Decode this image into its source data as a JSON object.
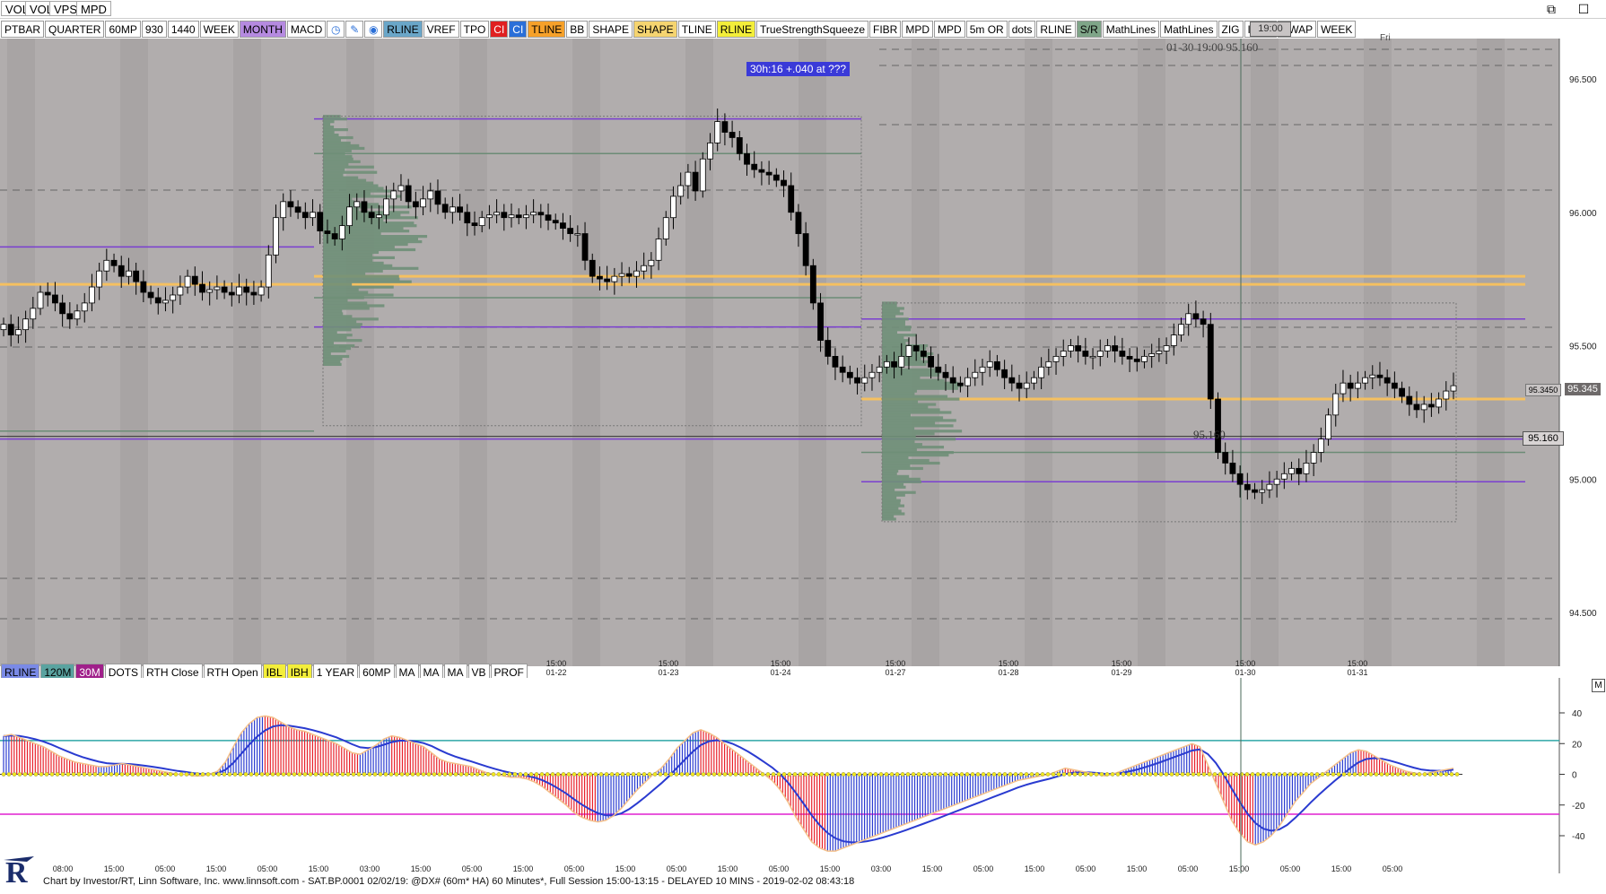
{
  "menu": [
    "VOL",
    "VOL",
    "VPS",
    "MPD"
  ],
  "window_controls": {
    "restore": "⧉",
    "maximize": "☐"
  },
  "toolbar_top": [
    {
      "label": "PTBAR",
      "bg": "#ffffff"
    },
    {
      "label": "QUARTER",
      "bg": "#ffffff"
    },
    {
      "label": "60MP",
      "bg": "#ffffff"
    },
    {
      "label": "930",
      "bg": "#ffffff"
    },
    {
      "label": "1440",
      "bg": "#ffffff"
    },
    {
      "label": "WEEK",
      "bg": "#ffffff"
    },
    {
      "label": "MONTH",
      "bg": "#b58ae0"
    },
    {
      "label": "MACD",
      "bg": "#ffffff"
    },
    {
      "label": "",
      "bg": "#ffffff",
      "icon": "clock-icon"
    },
    {
      "label": "",
      "bg": "#ffffff",
      "icon": "pencil-icon"
    },
    {
      "label": "",
      "bg": "#ffffff",
      "icon": "color-drop-icon"
    },
    {
      "label": "RLINE",
      "bg": "#6aa6c8"
    },
    {
      "label": "VREF",
      "bg": "#ffffff"
    },
    {
      "label": "TPO",
      "bg": "#ffffff"
    },
    {
      "label": "CI",
      "bg": "#e02020"
    },
    {
      "label": "CI",
      "bg": "#2a6fd8"
    },
    {
      "label": "TLINE",
      "bg": "#f6a12a"
    },
    {
      "label": "BB",
      "bg": "#ffffff"
    },
    {
      "label": "SHAPE",
      "bg": "#ffffff"
    },
    {
      "label": "SHAPE",
      "bg": "#f5d470"
    },
    {
      "label": "TLINE",
      "bg": "#ffffff"
    },
    {
      "label": "RLINE",
      "bg": "#f3ee3a"
    },
    {
      "label": "TrueStrengthSqueeze",
      "bg": "#ffffff"
    },
    {
      "label": "FIBR",
      "bg": "#ffffff"
    },
    {
      "label": "MPD",
      "bg": "#ffffff"
    },
    {
      "label": "MPD",
      "bg": "#ffffff"
    },
    {
      "label": "5m OR",
      "bg": "#ffffff"
    },
    {
      "label": "dots",
      "bg": "#ffffff"
    },
    {
      "label": "RLINE",
      "bg": "#ffffff"
    },
    {
      "label": "S/R",
      "bg": "#7fa588"
    },
    {
      "label": "MathLines",
      "bg": "#ffffff"
    },
    {
      "label": "MathLines",
      "bg": "#ffffff"
    },
    {
      "label": "ZIG",
      "bg": "#ffffff"
    },
    {
      "label": "INFO",
      "bg": "#ffffff"
    },
    {
      "label": "VWAP",
      "bg": "#ffffff"
    },
    {
      "label": "WEEK",
      "bg": "#ffffff"
    }
  ],
  "toolbar_bottom": [
    {
      "label": "RLINE",
      "bg": "#7a8ae6"
    },
    {
      "label": "120M",
      "bg": "#5aa3a0"
    },
    {
      "label": "30M",
      "bg": "#a0208a"
    },
    {
      "label": "DOTS",
      "bg": "#ffffff"
    },
    {
      "label": "RTH Close",
      "bg": "#ffffff"
    },
    {
      "label": "RTH Open",
      "bg": "#ffffff"
    },
    {
      "label": "IBL",
      "bg": "#f3ee3a"
    },
    {
      "label": "IBH",
      "bg": "#f3ee3a"
    },
    {
      "label": "1 YEAR",
      "bg": "#ffffff"
    },
    {
      "label": "60MP",
      "bg": "#ffffff"
    },
    {
      "label": "MA",
      "bg": "#ffffff"
    },
    {
      "label": "MA",
      "bg": "#ffffff"
    },
    {
      "label": "MA",
      "bg": "#ffffff"
    },
    {
      "label": "VB",
      "bg": "#ffffff"
    },
    {
      "label": "PROF",
      "bg": "#ffffff"
    }
  ],
  "annotations": {
    "cursor_time_box": "19:00",
    "cursor_readout": "01-30 19:00 95.160",
    "day_label": "Fri",
    "timer_box": "30h:16  +.040 at ???",
    "price_marker": "95.160",
    "last_price_small": "95.3450",
    "last_price": "95.345",
    "cursor_price": "95.160",
    "macd_flag": "M"
  },
  "status_text": "Chart by Investor/RT, Linn Software, Inc. www.linnsoft.com - SAT.BP.0001   02/02/19: @DX# (60m* HA) 60 Minutes*, Full Session 15:00-13:15 - DELAYED 10 MINS - 2019-02-02 08:43:18",
  "colors": {
    "chart_bg": "#b1adad",
    "session_bg": "#a8a4a4",
    "macd_bg": "#ffffff",
    "up_candle": "#ffffff",
    "down_candle": "#000000",
    "profile": "#6f8f78",
    "orange_line": "#f5c060",
    "purple_line": "#7a3fd0",
    "green_line": "#6c8c76",
    "macd_red": "#e8202a",
    "macd_blue": "#2a3bd0",
    "teal_line": "#2fa6a6",
    "magenta_line": "#e020d0"
  },
  "chart_data": [
    {
      "type": "candlestick",
      "title": "@DX# (60m* HA) 60 Minutes*",
      "y_axis_ticks": [
        96.5,
        96.0,
        95.5,
        95.0,
        94.5
      ],
      "ylim": [
        94.2,
        96.75
      ],
      "x_ticks": [
        "15:00 01-22",
        "15:00 01-23",
        "15:00 01-24",
        "15:00 01-27",
        "15:00 01-28",
        "15:00 01-29",
        "15:00 01-30",
        "15:00 01-31"
      ],
      "x_tick_labels_bottom": [
        "08:00",
        "15:00",
        "05:00",
        "15:00",
        "05:00",
        "15:00",
        "03:00",
        "15:00",
        "05:00",
        "15:00",
        "05:00",
        "15:00",
        "05:00",
        "15:00",
        "05:00",
        "15:00",
        "03:00",
        "15:00",
        "05:00",
        "15:00",
        "05:00",
        "15:00",
        "05:00",
        "15:00",
        "05:00",
        "15:00",
        "05:00"
      ],
      "closes": [
        95.58,
        95.54,
        95.56,
        95.6,
        95.64,
        95.7,
        95.69,
        95.66,
        95.62,
        95.6,
        95.63,
        95.66,
        95.72,
        95.78,
        95.82,
        95.8,
        95.76,
        95.78,
        95.74,
        95.7,
        95.68,
        95.66,
        95.67,
        95.69,
        95.72,
        95.76,
        95.73,
        95.7,
        95.71,
        95.72,
        95.7,
        95.69,
        95.72,
        95.7,
        95.69,
        95.72,
        95.84,
        95.98,
        96.04,
        96.02,
        96.0,
        95.98,
        96.0,
        95.93,
        95.92,
        95.9,
        95.95,
        96.02,
        96.04,
        96.0,
        95.98,
        95.99,
        96.05,
        96.08,
        96.1,
        96.04,
        96.02,
        96.05,
        96.08,
        96.03,
        96.0,
        96.02,
        96.0,
        95.96,
        95.95,
        95.98,
        95.99,
        96.0,
        95.98,
        95.99,
        95.98,
        95.99,
        96.0,
        95.99,
        95.97,
        95.96,
        95.94,
        95.92,
        95.92,
        95.82,
        95.76,
        95.75,
        95.74,
        95.76,
        95.77,
        95.76,
        95.78,
        95.8,
        95.82,
        95.9,
        95.98,
        96.06,
        96.1,
        96.15,
        96.08,
        96.2,
        96.26,
        96.34,
        96.3,
        96.28,
        96.22,
        96.18,
        96.16,
        96.15,
        96.14,
        96.12,
        96.1,
        96.0,
        95.92,
        95.8,
        95.66,
        95.52,
        95.46,
        95.42,
        95.4,
        95.38,
        95.36,
        95.38,
        95.4,
        95.42,
        95.44,
        95.42,
        95.46,
        95.5,
        95.48,
        95.46,
        95.42,
        95.4,
        95.38,
        95.36,
        95.35,
        95.38,
        95.4,
        95.42,
        95.44,
        95.41,
        95.38,
        95.36,
        95.34,
        95.36,
        95.38,
        95.42,
        95.44,
        95.46,
        95.48,
        95.5,
        95.48,
        95.46,
        95.46,
        95.48,
        95.5,
        95.48,
        95.46,
        95.45,
        95.44,
        95.46,
        95.47,
        95.48,
        95.5,
        95.54,
        95.58,
        95.62,
        95.6,
        95.58,
        95.3,
        95.1,
        95.06,
        95.02,
        94.98,
        94.96,
        94.95,
        94.96,
        94.98,
        95.0,
        95.02,
        95.04,
        95.02,
        95.06,
        95.1,
        95.15,
        95.24,
        95.32,
        95.36,
        95.34,
        95.36,
        95.38,
        95.39,
        95.38,
        95.36,
        95.34,
        95.31,
        95.28,
        95.26,
        95.28,
        95.27,
        95.3,
        95.33,
        95.35
      ]
    },
    {
      "type": "bar",
      "title": "MACD",
      "y_axis_ticks": [
        40,
        20,
        0,
        -20,
        -40
      ],
      "ylim": [
        -52,
        52
      ],
      "reference_lines": [
        22,
        -26
      ],
      "histogram": [
        25,
        26,
        24,
        22,
        20,
        18,
        15,
        12,
        10,
        8,
        7,
        6,
        5,
        5,
        6,
        7,
        6,
        5,
        4,
        3,
        2,
        1,
        0,
        0,
        -1,
        -1,
        0,
        2,
        8,
        18,
        27,
        33,
        37,
        38,
        37,
        34,
        31,
        29,
        28,
        26,
        24,
        22,
        20,
        17,
        14,
        13,
        16,
        19,
        23,
        25,
        24,
        22,
        20,
        18,
        14,
        10,
        8,
        7,
        6,
        5,
        3,
        1,
        0,
        -1,
        -2,
        -2,
        -3,
        -5,
        -8,
        -12,
        -16,
        -20,
        -25,
        -28,
        -30,
        -31,
        -30,
        -27,
        -22,
        -16,
        -10,
        -5,
        0,
        4,
        10,
        17,
        22,
        27,
        29,
        27,
        24,
        20,
        16,
        12,
        8,
        4,
        0,
        -4,
        -10,
        -18,
        -28,
        -36,
        -44,
        -48,
        -50,
        -50,
        -48,
        -46,
        -44,
        -42,
        -40,
        -38,
        -36,
        -34,
        -32,
        -30,
        -28,
        -26,
        -24,
        -22,
        -20,
        -18,
        -16,
        -14,
        -12,
        -10,
        -8,
        -6,
        -4,
        -3,
        -2,
        -1,
        0,
        2,
        4,
        3,
        2,
        1,
        0,
        -1,
        0,
        2,
        4,
        6,
        8,
        10,
        12,
        14,
        16,
        18,
        20,
        18,
        6,
        -6,
        -18,
        -30,
        -38,
        -44,
        -46,
        -44,
        -40,
        -34,
        -26,
        -18,
        -12,
        -6,
        -2,
        2,
        6,
        10,
        14,
        16,
        15,
        12,
        9,
        6,
        4,
        2,
        1,
        0,
        1,
        2,
        3,
        4
      ]
    }
  ]
}
